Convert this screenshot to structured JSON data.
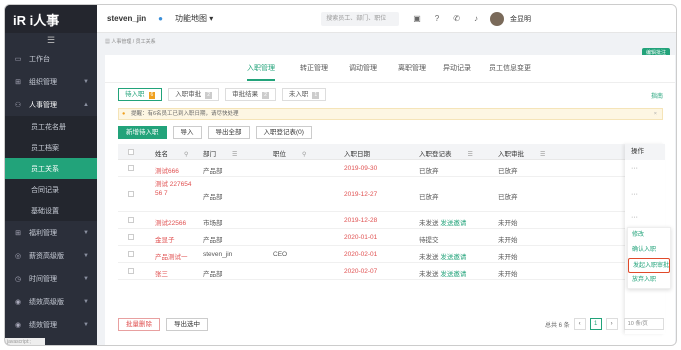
{
  "app": {
    "logo_text": "iR i人事",
    "user": "steven_jin",
    "map_label": "功能地图 ▾",
    "search_placeholder": "搜索员工、部门、职位",
    "user_name": "金显明"
  },
  "sidebar": {
    "toggle": "☰",
    "items": [
      {
        "label": "工作台",
        "icon": "▭"
      },
      {
        "label": "组织管理",
        "icon": "⊞"
      },
      {
        "label": "人事管理",
        "icon": "⚇"
      }
    ],
    "sub_items": [
      "员工花名册",
      "员工档案",
      "员工关系",
      "合同记录",
      "基础设置"
    ],
    "bottom_items": [
      {
        "label": "福利管理",
        "icon": "⊞"
      },
      {
        "label": "薪资高级版",
        "icon": "◎"
      },
      {
        "label": "时间管理",
        "icon": "◷"
      },
      {
        "label": "绩效高级版",
        "icon": "◉"
      },
      {
        "label": "绩效管理",
        "icon": "◉"
      }
    ],
    "status": "javascript:;"
  },
  "breadcrumb": "人事管理 / 员工关系",
  "note_button": "编辑批注",
  "tabs": [
    "入职管理",
    "转正管理",
    "调动管理",
    "离职管理",
    "异动记录",
    "员工信息变更"
  ],
  "guide": "指南",
  "subtabs": [
    {
      "label": "待入职",
      "count": "6"
    },
    {
      "label": "入职审批",
      "count": "2"
    },
    {
      "label": "审批结果",
      "count": "2"
    },
    {
      "label": "未入职",
      "count": "1"
    }
  ],
  "alert": "提醒：有6名员工已到入职日期，请尽快处理",
  "buttons": {
    "new": "新增待入职",
    "import": "导入",
    "export_all": "导出全部",
    "register": "入职登记表(0)"
  },
  "columns": [
    "姓名",
    "部门",
    "职位",
    "入职日期",
    "入职登记表",
    "入职审批",
    "操作"
  ],
  "rows": [
    {
      "name": "测试666",
      "dept": "产品部",
      "pos": "",
      "date": "2019-09-30",
      "reg": "已放弃",
      "reg_link": "",
      "appr": "已放弃"
    },
    {
      "name": "测试 22765456 7",
      "dept": "产品部",
      "pos": "",
      "date": "2019-12-27",
      "reg": "已放弃",
      "reg_link": "",
      "appr": "已放弃"
    },
    {
      "name": "测试22566",
      "dept": "市场部",
      "pos": "",
      "date": "2019-12-28",
      "reg": "未发送",
      "reg_link": "发送邀请",
      "appr": "未开始"
    },
    {
      "name": "金显子",
      "dept": "产品部",
      "pos": "",
      "date": "2020-01-01",
      "reg": "待提交",
      "reg_link": "",
      "appr": "未开始"
    },
    {
      "name": "产品测试一",
      "dept": "steven_jin",
      "pos": "CEO",
      "date": "2020-02-01",
      "reg": "未发送",
      "reg_link": "发送邀请",
      "appr": "未开始"
    },
    {
      "name": "张三",
      "dept": "产品部",
      "pos": "",
      "date": "2020-02-07",
      "reg": "未发送",
      "reg_link": "发送邀请",
      "appr": "未开始"
    }
  ],
  "popup": [
    "修改",
    "确认入职",
    "发起入职审批",
    "放弃入职"
  ],
  "footer": {
    "batch_delete": "批量删除",
    "export_selected": "导出选中",
    "total": "总共 6 条",
    "page": "1",
    "per_page": "10 条/页"
  }
}
